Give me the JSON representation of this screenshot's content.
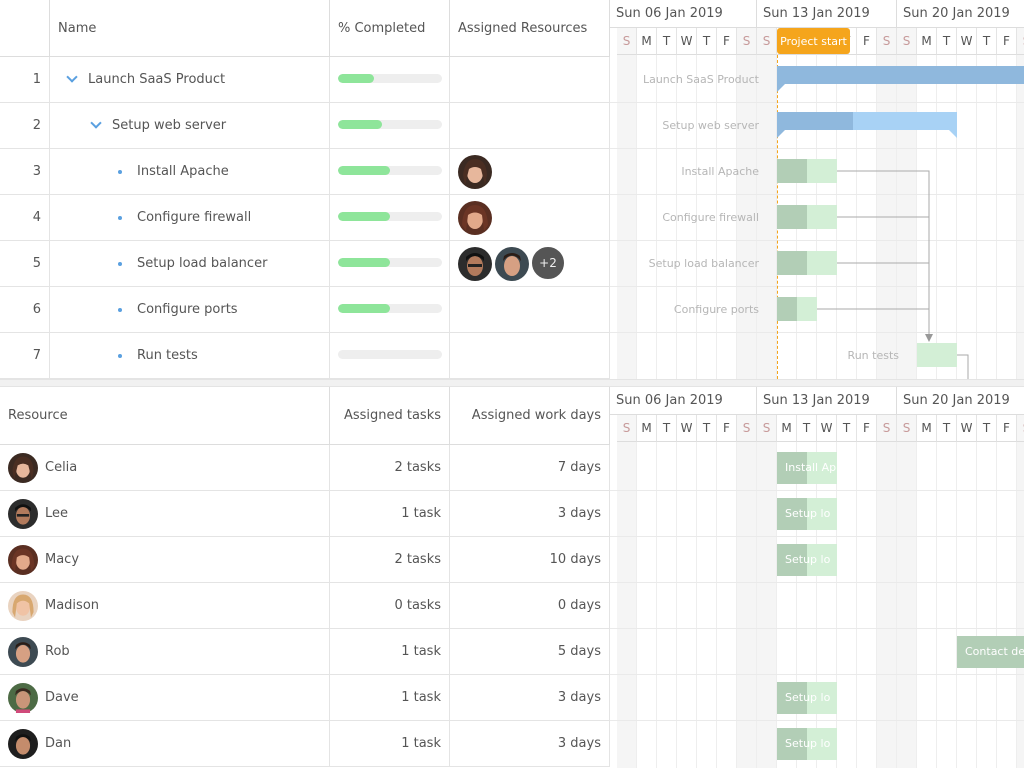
{
  "task_grid": {
    "headers": {
      "name": "Name",
      "completed": "% Completed",
      "resources": "Assigned Resources"
    },
    "rows": [
      {
        "id": "1",
        "name": "Launch SaaS Product",
        "level": 0,
        "type": "parent",
        "percent": 35,
        "avatars": []
      },
      {
        "id": "2",
        "name": "Setup web server",
        "level": 1,
        "type": "parent",
        "percent": 42,
        "avatars": []
      },
      {
        "id": "3",
        "name": "Install Apache",
        "level": 2,
        "type": "leaf",
        "percent": 50,
        "avatars": [
          "Celia"
        ]
      },
      {
        "id": "4",
        "name": "Configure firewall",
        "level": 2,
        "type": "leaf",
        "percent": 50,
        "avatars": [
          "Macy"
        ]
      },
      {
        "id": "5",
        "name": "Setup load balancer",
        "level": 2,
        "type": "leaf",
        "percent": 50,
        "avatars": [
          "Lee",
          "Rob"
        ],
        "more": "+2"
      },
      {
        "id": "6",
        "name": "Configure ports",
        "level": 2,
        "type": "leaf",
        "percent": 50,
        "avatars": []
      },
      {
        "id": "7",
        "name": "Run tests",
        "level": 2,
        "type": "leaf",
        "percent": 0,
        "avatars": []
      }
    ]
  },
  "resource_grid": {
    "headers": {
      "resource": "Resource",
      "tasks": "Assigned tasks",
      "days": "Assigned work days"
    },
    "rows": [
      {
        "name": "Celia",
        "tasks": "2 tasks",
        "days": "7 days"
      },
      {
        "name": "Lee",
        "tasks": "1 task",
        "days": "3 days"
      },
      {
        "name": "Macy",
        "tasks": "2 tasks",
        "days": "10 days"
      },
      {
        "name": "Madison",
        "tasks": "0 tasks",
        "days": "0 days"
      },
      {
        "name": "Rob",
        "tasks": "1 task",
        "days": "5 days"
      },
      {
        "name": "Dave",
        "tasks": "1 task",
        "days": "3 days"
      },
      {
        "name": "Dan",
        "tasks": "1 task",
        "days": "3 days"
      }
    ]
  },
  "timeline": {
    "weeks": [
      "Sun 06 Jan 2019",
      "Sun 13 Jan 2019",
      "Sun 20 Jan 2019"
    ],
    "days": [
      "S",
      "M",
      "T",
      "W",
      "T",
      "F",
      "S",
      "S",
      "M",
      "T",
      "W",
      "T",
      "F",
      "S",
      "S",
      "M",
      "T",
      "W",
      "T",
      "F",
      "S"
    ],
    "project_start_label": "Project start",
    "task_bars": [
      {
        "label": "Launch SaaS Product",
        "kind": "summary"
      },
      {
        "label": "Setup web server",
        "kind": "summary"
      },
      {
        "label": "Install Apache",
        "kind": "task"
      },
      {
        "label": "Configure firewall",
        "kind": "task"
      },
      {
        "label": "Setup load balancer",
        "kind": "task"
      },
      {
        "label": "Configure ports",
        "kind": "task"
      },
      {
        "label": "Run tests",
        "kind": "task"
      }
    ],
    "resource_bars": [
      "Install Ap",
      "Setup lo",
      "Setup lo",
      "",
      "Contact de",
      "Setup lo",
      "Setup lo"
    ]
  },
  "colors": {
    "accent": "#5aa0e0",
    "progress": "#8ee59a",
    "project_start": "#f5a51c",
    "summary_bar": "#8fb8dd",
    "summary_bar_light": "#a8d2f5",
    "task_done": "#b2ceb6",
    "task_rest": "#d3efd6"
  }
}
